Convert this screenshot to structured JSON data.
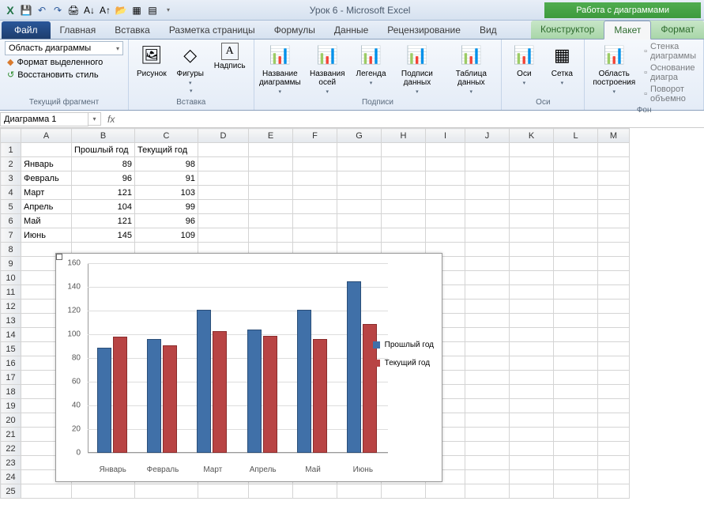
{
  "app": {
    "title": "Урок 6  -  Microsoft Excel",
    "chart_tools": "Работа с диаграммами"
  },
  "tabs": {
    "file": "Файл",
    "list": [
      "Главная",
      "Вставка",
      "Разметка страницы",
      "Формулы",
      "Данные",
      "Рецензирование",
      "Вид"
    ],
    "ctx": [
      "Конструктор",
      "Макет",
      "Формат"
    ],
    "active_ctx": 1
  },
  "ribbon": {
    "g1": {
      "label": "Текущий фрагмент",
      "selector": "Область диаграммы",
      "b1": "Формат выделенного",
      "b2": "Восстановить стиль"
    },
    "g2": {
      "label": "Вставка",
      "b1": "Рисунок",
      "b2": "Фигуры",
      "b3": "Надпись"
    },
    "g3": {
      "label": "Подписи",
      "b1": "Название диаграммы",
      "b2": "Названия осей",
      "b3": "Легенда",
      "b4": "Подписи данных",
      "b5": "Таблица данных"
    },
    "g4": {
      "label": "Оси",
      "b1": "Оси",
      "b2": "Сетка"
    },
    "g5": {
      "label": "Фон",
      "b1": "Область построения",
      "b2": "Стенка диаграммы",
      "b3": "Основание диагра",
      "b4": "Поворот объемно"
    }
  },
  "namebox": "Диаграмма 1",
  "sheet": {
    "cols": [
      "A",
      "B",
      "C",
      "D",
      "E",
      "F",
      "G",
      "H",
      "I",
      "J",
      "K",
      "L",
      "M"
    ],
    "headers": {
      "B1": "Прошлый год",
      "C1": "Текущий год"
    },
    "rows": [
      {
        "r": 1
      },
      {
        "r": 2,
        "A": "Январь",
        "B": 89,
        "C": 98
      },
      {
        "r": 3,
        "A": "Февраль",
        "B": 96,
        "C": 91
      },
      {
        "r": 4,
        "A": "Март",
        "B": 121,
        "C": 103
      },
      {
        "r": 5,
        "A": "Апрель",
        "B": 104,
        "C": 99
      },
      {
        "r": 6,
        "A": "Май",
        "B": 121,
        "C": 96
      },
      {
        "r": 7,
        "A": "Июнь",
        "B": 145,
        "C": 109
      }
    ],
    "total_rows_shown": 25
  },
  "chart_data": {
    "type": "bar",
    "categories": [
      "Январь",
      "Февраль",
      "Март",
      "Апрель",
      "Май",
      "Июнь"
    ],
    "series": [
      {
        "name": "Прошлый год",
        "color": "#4070a8",
        "values": [
          89,
          96,
          121,
          104,
          121,
          145
        ]
      },
      {
        "name": "Текущий год",
        "color": "#b84444",
        "values": [
          98,
          91,
          103,
          99,
          96,
          109
        ]
      }
    ],
    "ylim": [
      0,
      160
    ],
    "ystep": 20,
    "legend_position": "right"
  }
}
